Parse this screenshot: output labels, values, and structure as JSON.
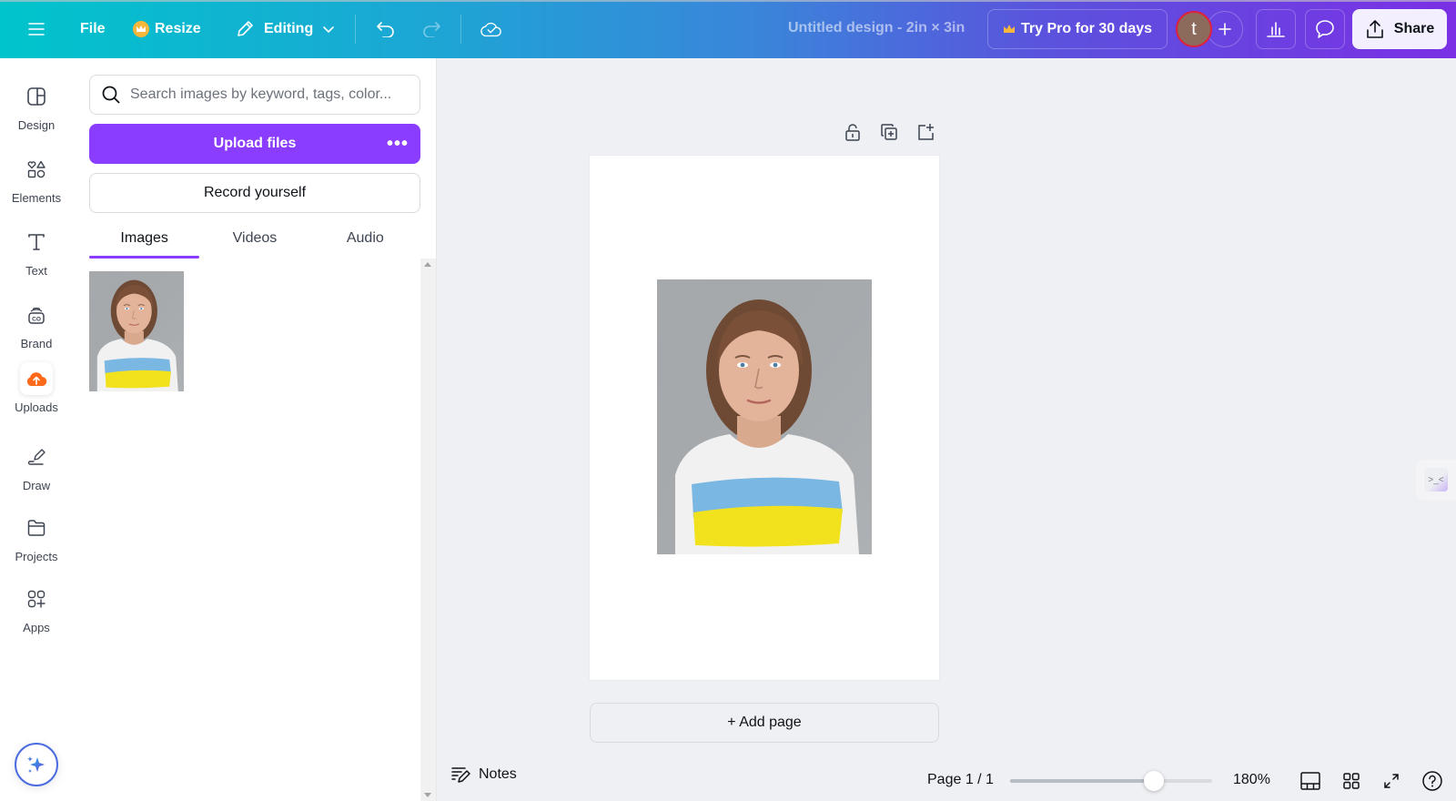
{
  "topbar": {
    "menu_icon": "hamburger-icon",
    "file_label": "File",
    "resize_label": "Resize",
    "editing_label": "Editing",
    "doc_title": "Untitled design - 2in × 3in",
    "try_pro_label": "Try Pro for 30 days",
    "avatar_initial": "t",
    "share_label": "Share",
    "colors": {
      "accent_purple": "#8b3dff",
      "avatar_bg": "#8c6a5c",
      "avatar_ring": "#e0203b"
    }
  },
  "rail": {
    "items": [
      {
        "label": "Design",
        "icon": "layout-icon"
      },
      {
        "label": "Elements",
        "icon": "shapes-icon"
      },
      {
        "label": "Text",
        "icon": "text-icon"
      },
      {
        "label": "Brand",
        "icon": "brand-icon"
      },
      {
        "label": "Uploads",
        "icon": "cloud-upload-icon",
        "active": true
      },
      {
        "label": "Draw",
        "icon": "pen-icon"
      },
      {
        "label": "Projects",
        "icon": "folder-icon"
      },
      {
        "label": "Apps",
        "icon": "apps-icon"
      }
    ]
  },
  "panel": {
    "search_placeholder": "Search images by keyword, tags, color...",
    "search_value": "",
    "upload_label": "Upload files",
    "upload_more": "•••",
    "record_label": "Record yourself",
    "tabs": [
      {
        "label": "Images",
        "active": true
      },
      {
        "label": "Videos"
      },
      {
        "label": "Audio"
      }
    ],
    "uploads": [
      {
        "alt": "Portrait of woman in white t-shirt with blue and yellow stripes"
      }
    ]
  },
  "canvas": {
    "add_page_label": "+ Add page",
    "photo_alt": "Portrait of woman in white t-shirt with blue and yellow stripes"
  },
  "bottombar": {
    "notes_label": "Notes",
    "page_indicator": "Page 1 / 1",
    "zoom_label": "180%",
    "zoom_fraction": 0.71
  }
}
